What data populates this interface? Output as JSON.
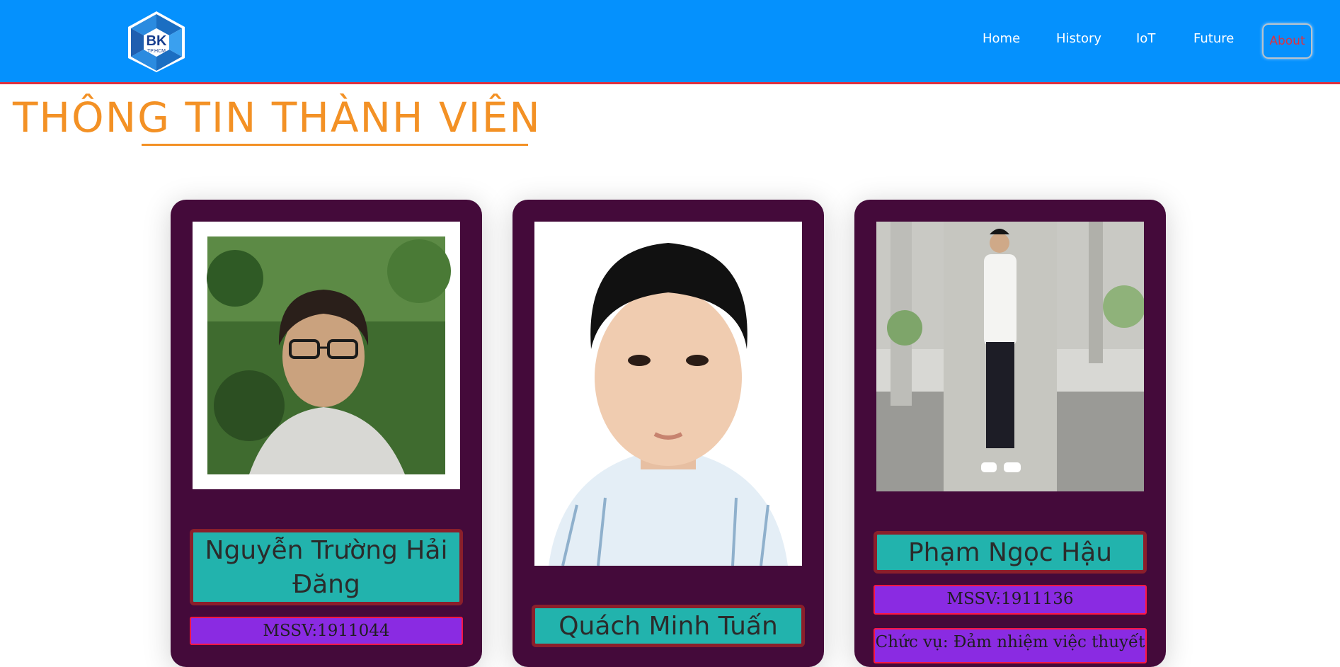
{
  "nav": {
    "logo_text": "BK",
    "logo_subtext": "TP.HCM",
    "items": [
      "Home",
      "History",
      "IoT",
      "Future"
    ],
    "active_item": "About"
  },
  "page": {
    "title": "THÔNG TIN THÀNH VIÊN"
  },
  "members": [
    {
      "name": "Nguyễn Trường Hải Đăng",
      "mssv": "MSSV:1911044"
    },
    {
      "name": "Quách Minh Tuấn"
    },
    {
      "name": "Phạm Ngọc Hậu",
      "mssv": "MSSV:1911136",
      "role": "Chức vụ: Đảm nhiệm việc thuyết"
    }
  ],
  "colors": {
    "navbar": "#0591fd",
    "title": "#f39125",
    "card": "#440a3a",
    "name_box": "#22b3ad",
    "info_box": "#8a2be2"
  }
}
